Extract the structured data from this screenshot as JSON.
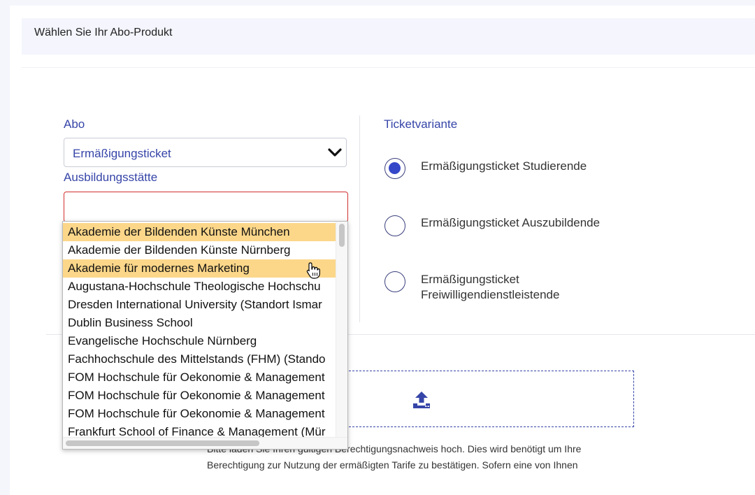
{
  "header": {
    "title": "Wählen Sie Ihr Abo-Produkt"
  },
  "abo": {
    "label": "Abo",
    "selected_value": "Ermäßigungsticket"
  },
  "ausbildung": {
    "label": "Ausbildungsstätte",
    "value": ""
  },
  "ticketvariante": {
    "label": "Ticketvariante",
    "options": [
      {
        "line1": "Ermäßigungsticket Studierende",
        "line2": "",
        "checked": true
      },
      {
        "line1": "Ermäßigungsticket Auszubildende",
        "line2": "",
        "checked": false
      },
      {
        "line1": "Ermäßigungsticket",
        "line2": "Freiwilligendienstleistende",
        "checked": false
      }
    ]
  },
  "dropdown": {
    "items": [
      {
        "label": "Akademie der Bildenden Künste München",
        "highlighted": true
      },
      {
        "label": "Akademie der Bildenden Künste Nürnberg",
        "highlighted": false
      },
      {
        "label": "Akademie für modernes Marketing",
        "highlighted": true
      },
      {
        "label": "Augustana-Hochschule Theologische Hochschu",
        "highlighted": false
      },
      {
        "label": "Dresden International University (Standort Ismar",
        "highlighted": false
      },
      {
        "label": "Dublin Business School",
        "highlighted": false
      },
      {
        "label": "Evangelische Hochschule Nürnberg",
        "highlighted": false
      },
      {
        "label": "Fachhochschule des Mittelstands (FHM) (Stando",
        "highlighted": false
      },
      {
        "label": "FOM Hochschule für Oekonomie & Management",
        "highlighted": false
      },
      {
        "label": "FOM Hochschule für Oekonomie & Management",
        "highlighted": false
      },
      {
        "label": "FOM Hochschule für Oekonomie & Management",
        "highlighted": false
      },
      {
        "label": "Frankfurt School of Finance & Management (Mür",
        "highlighted": false
      }
    ]
  },
  "upload": {
    "icon": "upload-icon",
    "hint_partial": "Bitte laden Sie Ihren gültigen",
    "hint_line1": "Berechtigungsnachweis hoch. Dies wird benötigt um Ihre",
    "hint_line2": "Berechtigung zur Nutzung der ermäßigten Tarife zu bestätigen. Sofern eine von Ihnen"
  },
  "colors": {
    "accent": "#3645a8",
    "radio_fill": "#3547c9",
    "error_border": "#d32f2f",
    "highlight": "#fcd78a"
  }
}
